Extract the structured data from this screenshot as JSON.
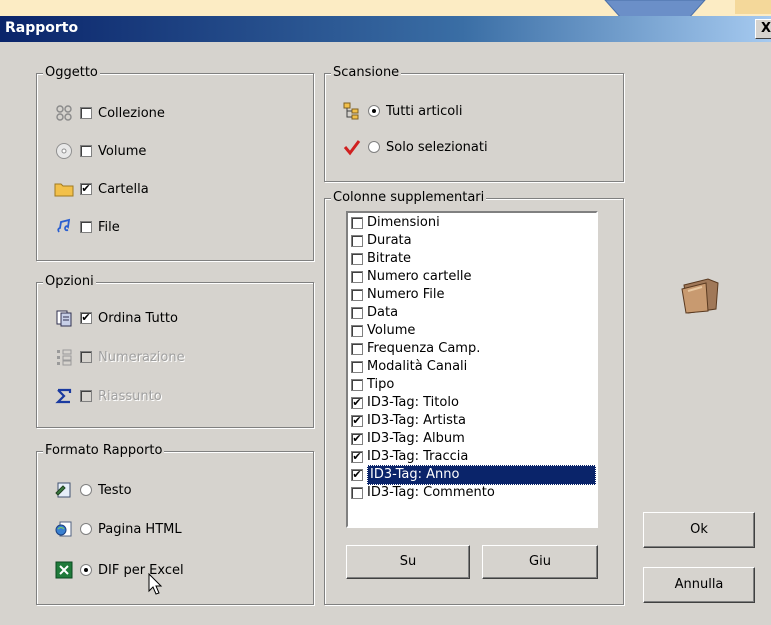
{
  "window": {
    "title": "Rapporto",
    "close_label": "X"
  },
  "oggetto": {
    "legend": "Oggetto",
    "items": [
      {
        "label": "Collezione",
        "checked": false,
        "icon": "collection-icon"
      },
      {
        "label": "Volume",
        "checked": false,
        "icon": "cd-icon"
      },
      {
        "label": "Cartella",
        "checked": true,
        "icon": "folder-icon"
      },
      {
        "label": "File",
        "checked": false,
        "icon": "music-file-icon"
      }
    ]
  },
  "opzioni": {
    "legend": "Opzioni",
    "items": [
      {
        "label": "Ordina Tutto",
        "checked": true,
        "disabled": false,
        "icon": "sort-icon"
      },
      {
        "label": "Numerazione",
        "checked": false,
        "disabled": true,
        "icon": "numbering-icon"
      },
      {
        "label": "Riassunto",
        "checked": false,
        "disabled": true,
        "icon": "sigma-icon"
      }
    ]
  },
  "formato": {
    "legend": "Formato Rapporto",
    "items": [
      {
        "label": "Testo",
        "selected": false,
        "icon": "text-file-icon"
      },
      {
        "label": "Pagina HTML",
        "selected": false,
        "icon": "html-icon"
      },
      {
        "label": "DIF per Excel",
        "selected": true,
        "icon": "excel-icon"
      }
    ]
  },
  "scansione": {
    "legend": "Scansione",
    "items": [
      {
        "label": "Tutti articoli",
        "selected": true,
        "icon": "tree-icon"
      },
      {
        "label": "Solo selezionati",
        "selected": false,
        "icon": "checkmark-icon"
      }
    ]
  },
  "colonne": {
    "legend": "Colonne supplementari",
    "items": [
      {
        "label": "Dimensioni",
        "checked": false
      },
      {
        "label": "Durata",
        "checked": false
      },
      {
        "label": "Bitrate",
        "checked": false
      },
      {
        "label": "Numero cartelle",
        "checked": false
      },
      {
        "label": "Numero File",
        "checked": false
      },
      {
        "label": "Data",
        "checked": false
      },
      {
        "label": "Volume",
        "checked": false
      },
      {
        "label": "Frequenza Camp.",
        "checked": false
      },
      {
        "label": "Modalità Canali",
        "checked": false
      },
      {
        "label": "Tipo",
        "checked": false
      },
      {
        "label": "ID3-Tag: Titolo",
        "checked": true
      },
      {
        "label": "ID3-Tag: Artista",
        "checked": true
      },
      {
        "label": "ID3-Tag: Album",
        "checked": true
      },
      {
        "label": "ID3-Tag: Traccia",
        "checked": true
      },
      {
        "label": "ID3-Tag: Anno",
        "checked": true,
        "selected": true
      },
      {
        "label": "ID3-Tag: Commento",
        "checked": false
      }
    ],
    "up_label": "Su",
    "down_label": "Giu"
  },
  "buttons": {
    "ok": "Ok",
    "cancel": "Annulla"
  }
}
